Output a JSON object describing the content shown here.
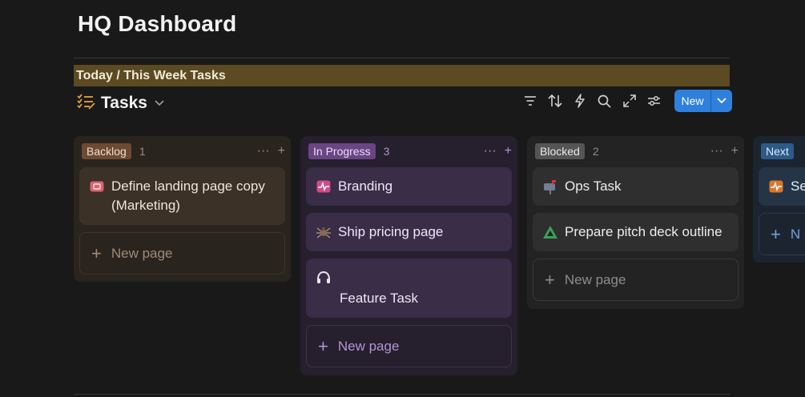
{
  "page": {
    "title": "HQ Dashboard"
  },
  "callout": {
    "text": "Today / This Week Tasks"
  },
  "database": {
    "title": "Tasks",
    "icon": "tasks-checklist-icon",
    "toolbar": {
      "icons": [
        "filter-icon",
        "sort-icon",
        "automation-bolt-icon",
        "search-icon",
        "expand-icon",
        "settings-sliders-icon"
      ],
      "new_label": "New"
    }
  },
  "board": {
    "columns": [
      {
        "label": "Backlog",
        "count": "1",
        "cards": [
          {
            "title": "Define landing page copy (Marketing)",
            "icon": "ticket-icon"
          }
        ],
        "new_page_label": "New page"
      },
      {
        "label": "In Progress",
        "count": "3",
        "cards": [
          {
            "title": "Branding",
            "icon": "activity-pulse-icon"
          },
          {
            "title": "Ship pricing page",
            "icon": "spider-icon"
          },
          {
            "title": "Feature Task",
            "icon": "headphones-icon"
          }
        ],
        "new_page_label": "New page"
      },
      {
        "label": "Blocked",
        "count": "2",
        "cards": [
          {
            "title": "Ops Task",
            "icon": "mailbox-icon"
          },
          {
            "title": "Prepare pitch deck outline",
            "icon": "triangle-warning-icon"
          }
        ],
        "new_page_label": "New page"
      },
      {
        "label": "Next",
        "cards": [
          {
            "title": "Se",
            "icon": "activity-pulse-icon"
          }
        ],
        "new_page_label": "N"
      }
    ]
  },
  "colors": {
    "background": "#191919",
    "callout_bg": "#5b4a22",
    "accent_blue": "#2f80dd"
  }
}
